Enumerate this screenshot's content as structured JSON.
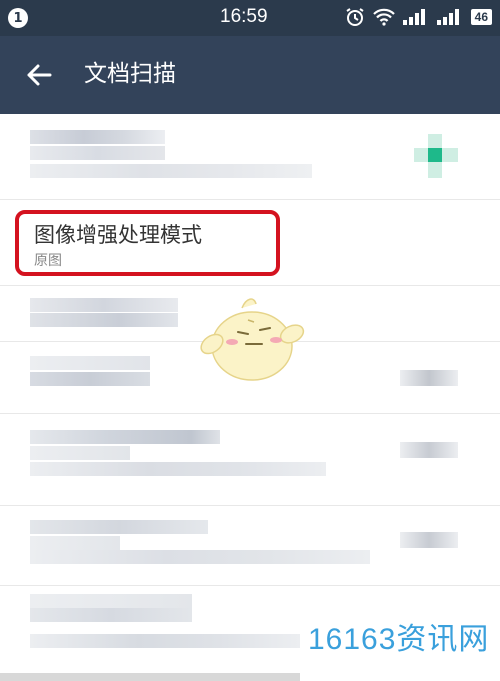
{
  "status_bar": {
    "notification_count": "1",
    "time": "16:59",
    "battery": "46",
    "icons": [
      "alarm-icon",
      "wifi-icon",
      "signal-icon",
      "signal-icon"
    ]
  },
  "header": {
    "back_icon": "arrow-left-icon",
    "title": "文档扫描"
  },
  "settings": {
    "enhance_mode": {
      "label": "图像增强处理模式",
      "value": "原图"
    }
  },
  "watermark": "16163资讯网",
  "colors": {
    "status_bar": "#2b3a4c",
    "app_bar": "#33435a",
    "highlight": "#d4121f",
    "watermark": "#3aa0dc"
  }
}
